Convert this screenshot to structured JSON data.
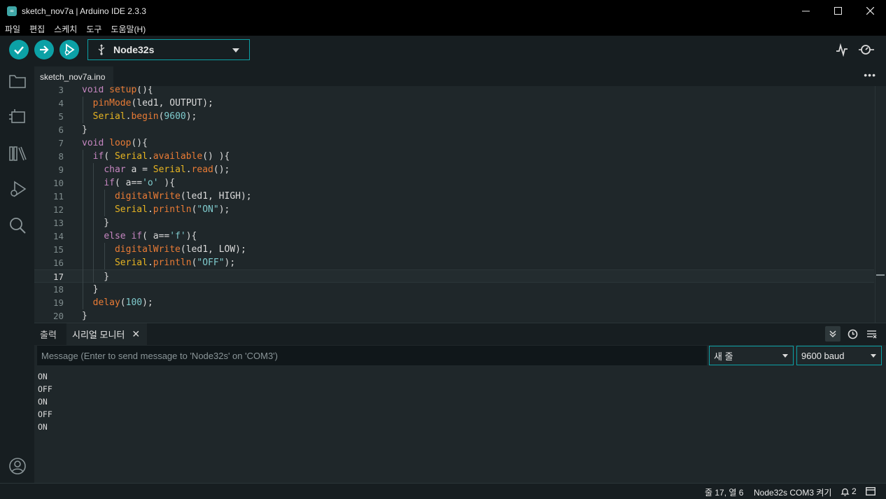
{
  "window": {
    "title": "sketch_nov7a | Arduino IDE 2.3.3",
    "app_icon_glyph": "∞"
  },
  "menu": [
    "파일",
    "편집",
    "스케치",
    "도구",
    "도움말(H)"
  ],
  "toolbar": {
    "board": "Node32s"
  },
  "editor": {
    "tab": "sketch_nov7a.ino",
    "current_line": 17,
    "lines": [
      {
        "n": "3"
      },
      {
        "n": "4"
      },
      {
        "n": "5"
      },
      {
        "n": "6"
      },
      {
        "n": "7"
      },
      {
        "n": "8"
      },
      {
        "n": "9"
      },
      {
        "n": "10"
      },
      {
        "n": "11"
      },
      {
        "n": "12"
      },
      {
        "n": "13"
      },
      {
        "n": "14"
      },
      {
        "n": "15"
      },
      {
        "n": "16"
      },
      {
        "n": "17"
      },
      {
        "n": "18"
      },
      {
        "n": "19"
      },
      {
        "n": "20"
      }
    ]
  },
  "panel": {
    "tabs": [
      "출력",
      "시리얼 모니터"
    ],
    "message_placeholder": "Message (Enter to send message to 'Node32s' on 'COM3')",
    "line_ending": "새 줄",
    "baud": "9600 baud",
    "output": [
      "ON",
      "OFF",
      "ON",
      "OFF",
      "ON"
    ]
  },
  "status": {
    "position": "줄 17, 열 6",
    "board_port": "Node32s COM3 켜기",
    "notifications": "2"
  },
  "colors": {
    "accent": "#0ca1a6",
    "background": "#171e21",
    "editor_bg": "#1f272a"
  }
}
